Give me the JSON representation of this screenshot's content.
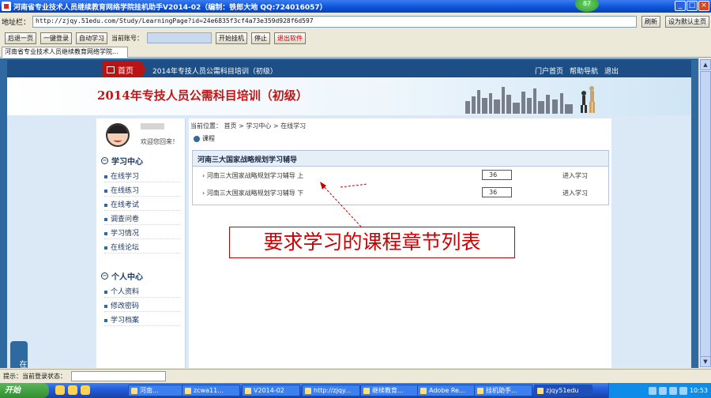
{
  "window": {
    "title": "河南省专业技术人员继续教育网络学院挂机助手V2014-02（编制：铁郎大地 QQ:724016057）",
    "clock_badge": "87"
  },
  "address_bar": {
    "label": "地址栏：",
    "url": "http://zjqy.51edu.com/Study/LearningPage?id=24e6835f3cf4a73e359d928f6d597",
    "refresh_label": "刷新",
    "shortcut_label": "设为默认主页"
  },
  "toolbar": {
    "buttons": [
      "后退一页",
      "一键登录",
      "自动学习"
    ],
    "account_label": "当前账号：",
    "start_label": "开始挂机",
    "stop_label": "停止",
    "exit_label": "退出软件"
  },
  "tab": {
    "label": "河南省专业技术人员继续教育网络学院..."
  },
  "site": {
    "home_label": "首页",
    "nav_title": "2014年专技人员公需科目培训（初级）",
    "nav_links": [
      "门户首页",
      "帮助导航",
      "退出"
    ],
    "banner_title": "2014年专技人员公需科目培训（初级）"
  },
  "sidebar": {
    "welcome": "欢迎您回来！",
    "study_center": {
      "title": "学习中心",
      "items": [
        "在线学习",
        "在线练习",
        "在线考试",
        "调查问卷",
        "学习情况",
        "在线论坛"
      ]
    },
    "personal_center": {
      "title": "个人中心",
      "items": [
        "个人资料",
        "修改密码",
        "学习档案"
      ]
    }
  },
  "main": {
    "breadcrumb": "当前位置： 首页 > 学习中心 > 在线学习",
    "course_tag": "课程",
    "chapter_heading": "河南三大国家战略规划学习辅导",
    "chapters": [
      {
        "title": "河南三大国家战略规划学习辅导 上",
        "value": "36",
        "action": "进入学习"
      },
      {
        "title": "河南三大国家战略规划学习辅导 下",
        "value": "36",
        "action": "进入学习"
      }
    ]
  },
  "annotation": {
    "text": "要求学习的课程章节列表"
  },
  "consult": {
    "label": "在线咨询»"
  },
  "status_bar": {
    "text": "提示：当前登录状态："
  },
  "taskbar": {
    "start_label": "开始",
    "tasks": [
      "河南...",
      "zcwa11...",
      "V2014-02",
      "http://zjqy...",
      "继续教育...",
      "Adobe Re...",
      "挂机助手...",
      "zjqy51edu"
    ],
    "clock": "10:53"
  }
}
